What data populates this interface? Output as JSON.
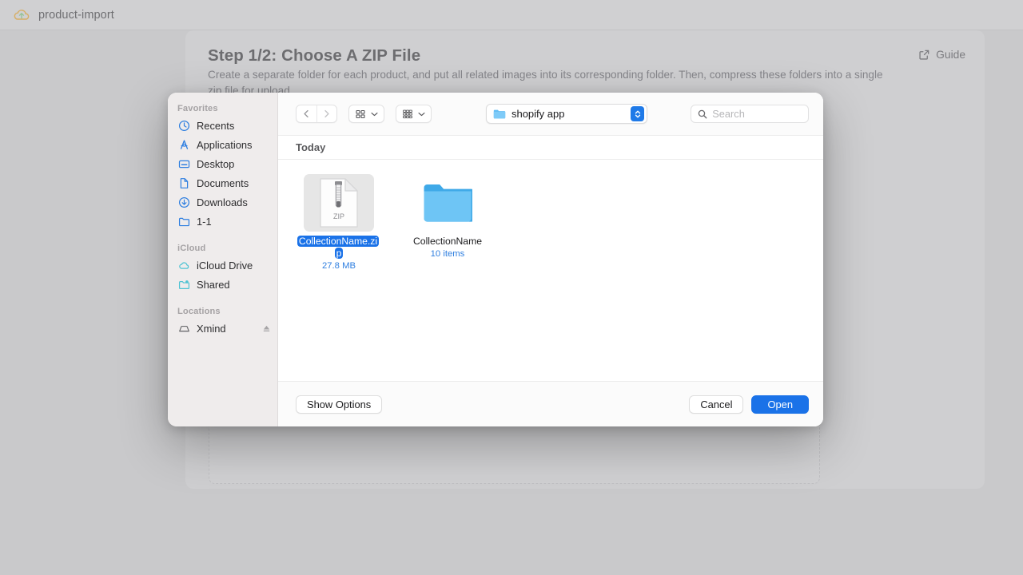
{
  "app": {
    "title": "product-import",
    "logo_icon": "cloud-upload-icon"
  },
  "page": {
    "heading": "Step 1/2: Choose A ZIP File",
    "description": "Create a separate folder for each product, and put all related images into its corresponding folder. Then, compress these folders into a single zip file for upload.",
    "guide_label": "Guide",
    "guide_icon": "external-link-icon"
  },
  "dialog": {
    "toolbar": {
      "back_icon": "chevron-left-icon",
      "forward_icon": "chevron-right-icon",
      "view_icon": "grid-view-icon",
      "group_icon": "group-view-icon",
      "caret_icon": "chevron-down-icon",
      "path_label": "shopify app",
      "path_folder_icon": "folder-icon",
      "path_stepper_icon": "up-down-chevrons-icon",
      "search_icon": "search-icon",
      "search_placeholder": "Search",
      "search_value": ""
    },
    "sidebar": {
      "groups": [
        {
          "title": "Favorites",
          "items": [
            {
              "label": "Recents",
              "icon": "clock-icon"
            },
            {
              "label": "Applications",
              "icon": "applications-icon"
            },
            {
              "label": "Desktop",
              "icon": "desktop-icon"
            },
            {
              "label": "Documents",
              "icon": "document-icon"
            },
            {
              "label": "Downloads",
              "icon": "download-icon"
            },
            {
              "label": "1-1",
              "icon": "folder-icon"
            }
          ]
        },
        {
          "title": "iCloud",
          "items": [
            {
              "label": "iCloud Drive",
              "icon": "cloud-icon"
            },
            {
              "label": "Shared",
              "icon": "shared-folder-icon"
            }
          ]
        },
        {
          "title": "Locations",
          "items": [
            {
              "label": "Xmind",
              "icon": "disk-icon",
              "eject": "eject-icon"
            }
          ]
        }
      ]
    },
    "group_header": "Today",
    "files": [
      {
        "name_line1": "CollectionName.zi",
        "name_line2": "p",
        "full_name": "CollectionName.zip",
        "subtitle": "27.8 MB",
        "icon": "zip-file-icon",
        "badge_text": "ZIP",
        "selected": true
      },
      {
        "name_line1": "CollectionName",
        "name_line2": "",
        "full_name": "CollectionName",
        "subtitle": "10 items",
        "icon": "folder-icon",
        "badge_text": "",
        "selected": false
      }
    ],
    "footer": {
      "show_options_label": "Show Options",
      "cancel_label": "Cancel",
      "open_label": "Open"
    }
  },
  "colors": {
    "accent_blue": "#1a72e8",
    "folder_blue": "#62bdf5",
    "sidebar_icon_blue": "#2f7fe0",
    "teal": "#4fc3d3"
  }
}
